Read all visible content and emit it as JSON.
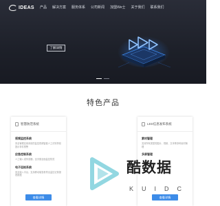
{
  "header": {
    "logo_text": "IDEAS",
    "nav": [
      "产品",
      "解决方案",
      "服务体系",
      "公司新闻",
      "加盟We士",
      "关于我们",
      "联系我们"
    ]
  },
  "hero": {
    "button_label": "了解详情",
    "slides": 2,
    "active_slide": 0
  },
  "section": {
    "title": "特色产品"
  },
  "cards": [
    {
      "title": "智慧防范系统",
      "features": [
        {
          "title": "视频监控系统",
          "desc": "安全管理应用系统的监控视频智能人工识别事前提示事件预警"
        },
        {
          "title": "应急控制系统",
          "desc": "人工输入或传感器，全天候全面监控防范"
        },
        {
          "title": "电子巡检系统",
          "desc": "安全接入平台，支持移动端查看导出监控记录报表数据"
        }
      ],
      "button_label": "查看详情"
    },
    {
      "title": "LED信息发布系统",
      "features": [
        {
          "title": "素材管理",
          "desc": "支持所有类型的图片、视频、文本等多种素材管理"
        },
        {
          "title": "多屏管理",
          "desc": ""
        }
      ],
      "button_label": "查看详情"
    }
  ],
  "watermark": {
    "text": "酷数据",
    "sub": "KUIDC"
  },
  "colors": {
    "hero_bg": "#1d2029",
    "accent": "#3d8ce8",
    "art_glow": "#2f7ff0"
  }
}
